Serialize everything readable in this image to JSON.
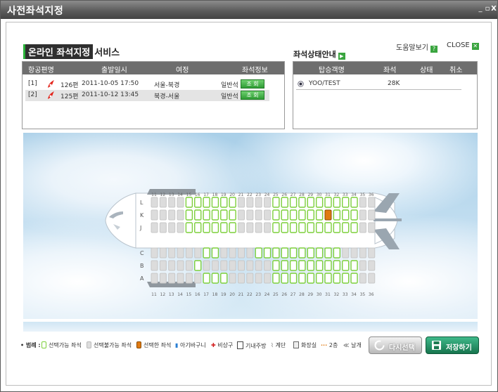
{
  "window": {
    "title": "사전좌석지정",
    "min": "_",
    "restore": "▫",
    "close": "X"
  },
  "header": {
    "service_title_highlight": "온라인 좌석지정",
    "service_title_rest": "서비스",
    "status_guide": "좌석상태안내",
    "help_label": "도움말보기",
    "close_label": "CLOSE"
  },
  "flights": {
    "columns": [
      "항공편명",
      "출발일시",
      "여정",
      "좌석정보"
    ],
    "rows": [
      {
        "index": "[1]",
        "flight": "126편",
        "datetime": "2011-10-05 17:50",
        "route": "서울-북경",
        "class": "일반석",
        "button": "조 회",
        "selected": false
      },
      {
        "index": "[2]",
        "flight": "125편",
        "datetime": "2011-10-12 13:45",
        "route": "북경-서울",
        "class": "일반석",
        "button": "조 회",
        "selected": true
      }
    ]
  },
  "passengers": {
    "columns": [
      "탑승객명",
      "좌석",
      "상태",
      "취소"
    ],
    "rows": [
      {
        "name": "YOO/TEST",
        "seat": "28K",
        "status": "",
        "cancel": ""
      }
    ]
  },
  "seatmap": {
    "columns": [
      "11",
      "12",
      "13",
      "14",
      "15",
      "16",
      "17",
      "18",
      "19",
      "20",
      "21",
      "22",
      "23",
      "24",
      "25",
      "26",
      "27",
      "28",
      "29",
      "30",
      "31",
      "32",
      "33",
      "34",
      "35",
      "36"
    ],
    "rows": [
      "L",
      "K",
      "J",
      "C",
      "B",
      "A"
    ],
    "status_rows": {
      "L": "uuuuaaaaaauuuuaaaaaaaaaauu",
      "K": "uuuuaaaaaauuuuaaaaaasaaauu",
      "J": "uuuuaaaaaauuuuaaaaaaaaaauu",
      "C": "uuuuuuaauuuuaaaaaaaaaauuuu",
      "B": "uuuuuauuuuuuuuaaaaaaaaaauu",
      "A": "uuuuuuaaauuuuuaaaaaaaaaauu"
    },
    "colors": {
      "available": "#7ccf3a",
      "unavailable": "#c8c8c8",
      "selected": "#e07a12",
      "selected_border": "#8a4a00"
    }
  },
  "legend": {
    "label": "• 범례 :",
    "items": [
      {
        "name": "선택가능 좌석",
        "type": "available"
      },
      {
        "name": "선택불가능 좌석",
        "type": "unavailable"
      },
      {
        "name": "선택한 좌석",
        "type": "selected"
      },
      {
        "name": "아기바구니",
        "type": "bassinet"
      },
      {
        "name": "비상구",
        "type": "exit"
      },
      {
        "name": "기내주방",
        "type": "galley"
      },
      {
        "name": "계단",
        "type": "stairs"
      },
      {
        "name": "화장실",
        "type": "lavatory"
      },
      {
        "name": "2층",
        "type": "upper"
      },
      {
        "name": "날개",
        "type": "wing"
      }
    ]
  },
  "buttons": {
    "reset": "다시선택",
    "save": "저장하기"
  }
}
